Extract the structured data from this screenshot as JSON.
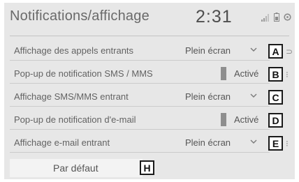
{
  "header": {
    "title": "Notifications/affichage",
    "time": "2:31"
  },
  "rows": [
    {
      "label": "Affichage des appels entrants",
      "value": "Plein écran",
      "badge": "A",
      "control": "dropdown"
    },
    {
      "label": "Pop-up de notification SMS / MMS",
      "value": "Activé",
      "badge": "B",
      "control": "toggle"
    },
    {
      "label": "Affichage SMS/MMS entrant",
      "value": "Plein écran",
      "badge": "C",
      "control": "dropdown"
    },
    {
      "label": "Pop-up de notification d'e-mail",
      "value": "Activé",
      "badge": "D",
      "control": "toggle"
    },
    {
      "label": "Affichage e-mail entrant",
      "value": "Plein écran",
      "badge": "E",
      "control": "dropdown"
    }
  ],
  "default_button": {
    "label": "Par défaut",
    "badge": "H"
  },
  "icons": {
    "status": [
      "signal-icon",
      "battery-icon",
      "settings-icon"
    ],
    "dropdown": "chevron-down-icon"
  },
  "colors": {
    "screen_bg": "#e7e7e7",
    "text": "#636363",
    "toggle_on": "#8e8e8e"
  }
}
